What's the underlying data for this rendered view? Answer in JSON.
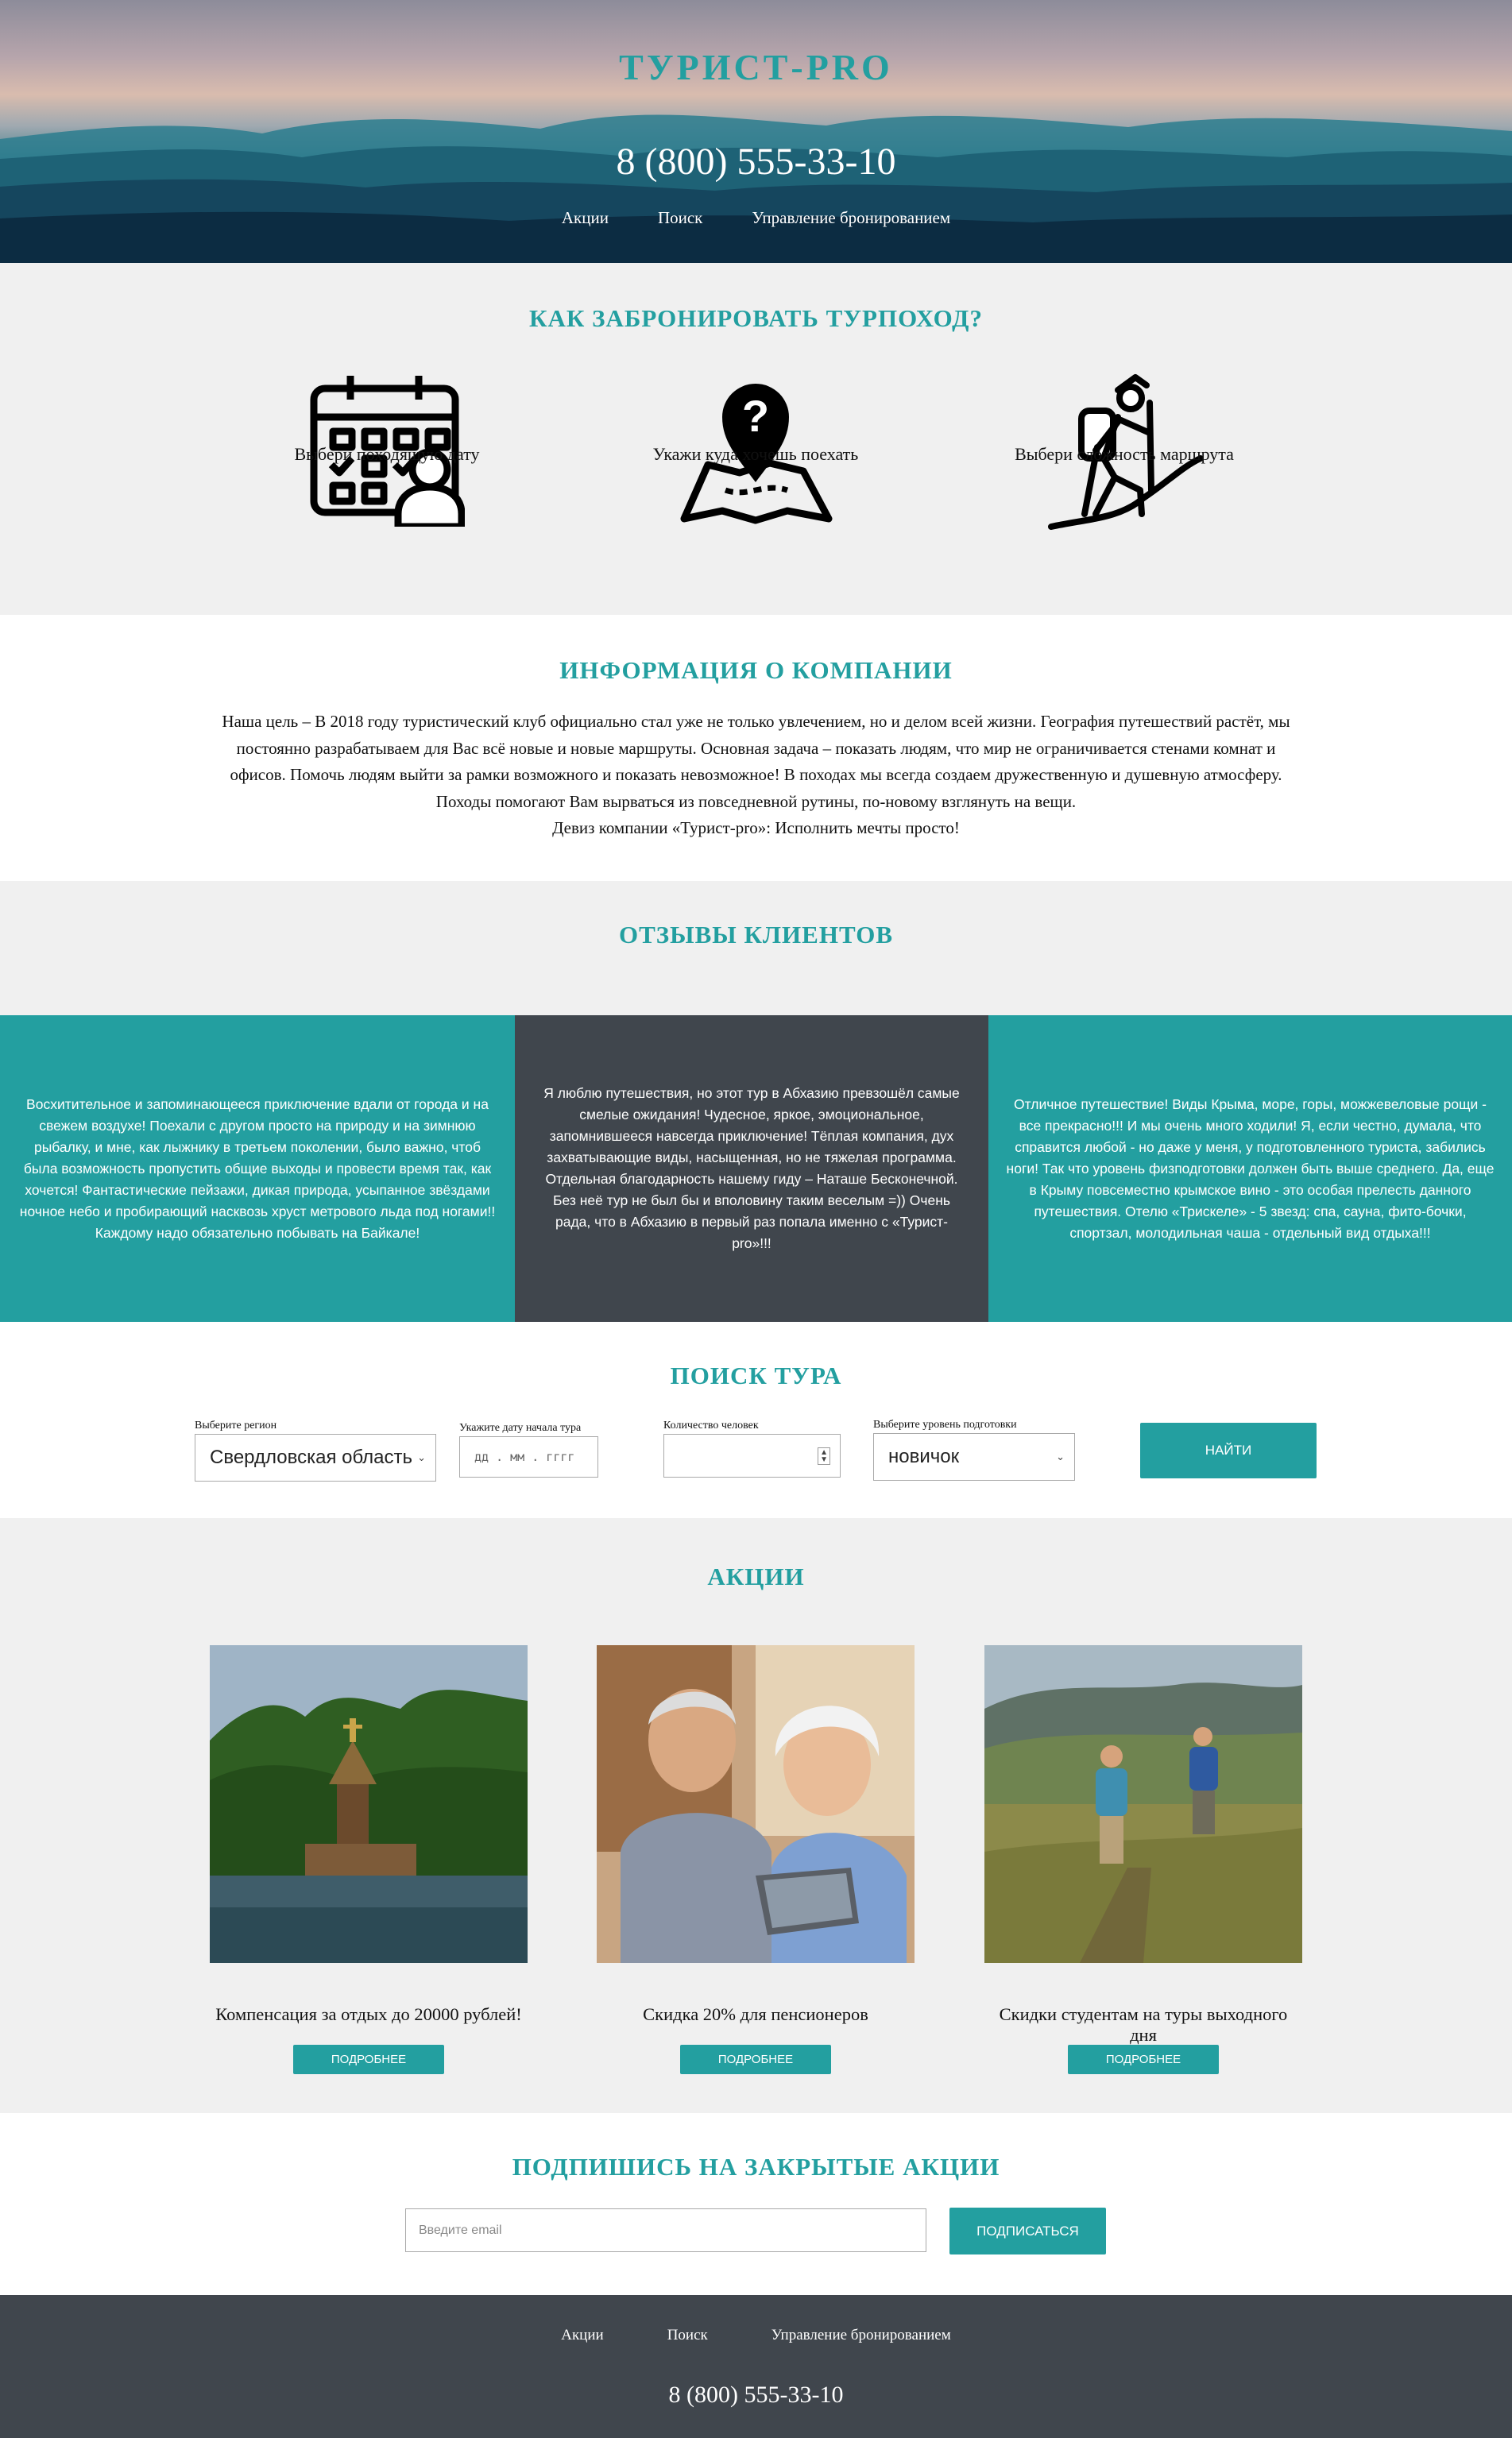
{
  "site": {
    "brand": "ТУРИСТ-PRO",
    "phone": "8 (800) 555-33-10"
  },
  "nav": [
    "Акции",
    "Поиск",
    "Управление бронированием"
  ],
  "howto": {
    "title": "КАК ЗАБРОНИРОВАТЬ ТУРПОХОД?",
    "steps": [
      {
        "icon": "calendar-user-icon",
        "label": "Выбери походящую дату"
      },
      {
        "icon": "map-question-icon",
        "label": "Укажи куда хочешь поехать"
      },
      {
        "icon": "hiker-icon",
        "label": "Выбери сложность маршрута"
      }
    ]
  },
  "info": {
    "title": "ИНФОРМАЦИЯ О КОМПАНИИ",
    "lines": [
      "Наша цель – В 2018 году туристический клуб официально стал уже не только увлечением, но и делом всей жизни. География путешествий растёт, мы",
      "постоянно разрабатываем для Вас всё новые и новые маршруты. Основная задача – показать людям, что мир не ограничивается стенами комнат и",
      "офисов. Помочь людям выйти за рамки возможного и показать невозможное! В походах мы всегда создаем дружественную и душевную атмосферу.",
      "Походы помогают Вам вырваться из повседневной рутины, по-новому взглянуть на вещи.",
      "Девиз компании «Турист-pro»: Исполнить мечты просто!"
    ]
  },
  "reviews": {
    "title": "ОТЗЫВЫ КЛИЕНТОВ",
    "items": [
      {
        "text": "Восхитительное и запоминающееся приключение вдали от города и на свежем воздухе! Поехали с другом просто на природу и на зимнюю рыбалку, и мне, как лыжнику в третьем поколении, было важно, чтоб была возможность пропустить общие выходы и провести время так, как хочется! Фантастические пейзажи, дикая природа, усыпанное звёздами ночное небо и пробирающий насквозь хруст метрового льда под ногами!! Каждому надо обязательно побывать на Байкале!",
        "bg": "#239fa0"
      },
      {
        "text": "Я люблю путешествия, но этот тур в Абхазию превзошёл самые смелые ожидания! Чудесное, яркое, эмоциональное, запомнившееся навсегда приключение! Тёплая компания, дух захватывающие виды, насыщенная, но не тяжелая программа. Отдельная благодарность нашему гиду – Наташе Бесконечной. Без неё тур не был бы и вполовину таким веселым =)) Очень рада, что в Абхазию в первый раз попала именно с «Турист-pro»!!!",
        "bg": "#40464d"
      },
      {
        "text": "Отличное путешествие! Виды Крыма, море, горы, можжевеловые рощи - все прекрасно!!! И мы очень много ходили! Я, если честно, думала, что справится любой - но даже у меня, у подготовленного туриста, забились ноги! Так что уровень физподготовки должен быть выше среднего. Да, еще в Крыму повсеместно крымское вино - это особая прелесть данного путешествия. Отелю «Трискеле» - 5 звезд: спа, сауна, фито-бочки, спортзал, молодильная чаша - отдельный вид отдыха!!!",
        "bg": "#239fa0"
      }
    ]
  },
  "search": {
    "title": "ПОИСК ТУРА",
    "region": {
      "label": "Выберите регион",
      "value": "Свердловская область"
    },
    "date": {
      "label": "Укажите дату начала тура",
      "placeholder": "дд . мм . гггг"
    },
    "people": {
      "label": "Количество человек",
      "value": ""
    },
    "level": {
      "label": "Выберите уровень подготовки",
      "value": "новичок"
    },
    "button": "НАЙТИ"
  },
  "promos": {
    "title": "АКЦИИ",
    "items": [
      {
        "caption": "Компенсация за отдых до 20000 рублей!",
        "button": "ПОДРОБНЕЕ"
      },
      {
        "caption": "Скидка 20% для пенсионеров",
        "button": "ПОДРОБНЕЕ"
      },
      {
        "caption": "Скидки студентам на туры выходного дня",
        "button": "ПОДРОБНЕЕ"
      }
    ]
  },
  "subscribe": {
    "title": "ПОДПИШИСЬ НА ЗАКРЫТЫЕ АКЦИИ",
    "placeholder": "Введите email",
    "button": "ПОДПИСАТЬСЯ"
  },
  "colors": {
    "accent": "#239fa0",
    "dark": "#40464d",
    "light_bg": "#f0f0f0"
  }
}
